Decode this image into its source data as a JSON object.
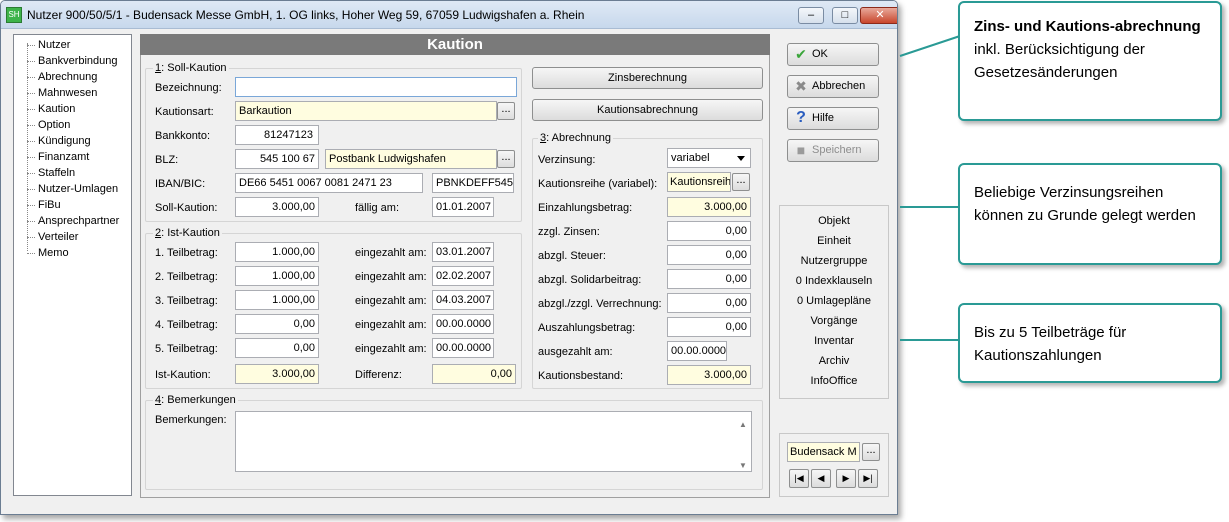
{
  "window": {
    "title": "Nutzer 900/50/5/1 - Budensack Messe GmbH, 1. OG links, Hoher Weg 59, 67059 Ludwigshafen a. Rhein",
    "icon_text": "SH"
  },
  "tree": {
    "items": [
      "Nutzer",
      "Bankverbindung",
      "Abrechnung",
      "Mahnwesen",
      "Kaution",
      "Option",
      "Kündigung",
      "Finanzamt",
      "Staffeln",
      "Nutzer-Umlagen",
      "FiBu",
      "Ansprechpartner",
      "Verteiler",
      "Memo"
    ]
  },
  "header": {
    "title": "Kaution"
  },
  "soll": {
    "group_num": "1",
    "group_rest": ": Soll-Kaution",
    "bezeichnung_label": "Bezeichnung:",
    "bezeichnung_value": "",
    "kautionsart_label": "Kautionsart:",
    "kautionsart_value": "Barkaution",
    "bankkonto_label": "Bankkonto:",
    "bankkonto_value": "81247123",
    "blz_label": "BLZ:",
    "blz_value": "545 100 67",
    "bank_name": "Postbank Ludwigshafen",
    "iban_label": "IBAN/BIC:",
    "iban_value": "DE66 5451 0067 0081 2471 23",
    "bic_value": "PBNKDEFF545",
    "soll_label": "Soll-Kaution:",
    "soll_value": "3.000,00",
    "faellig_label": "fällig am:",
    "faellig_value": "01.01.2007"
  },
  "ist": {
    "group_num": "2",
    "group_rest": ": Ist-Kaution",
    "rows": [
      {
        "label": "1. Teilbetrag:",
        "value": "1.000,00",
        "date_label": "eingezahlt am:",
        "date": "03.01.2007"
      },
      {
        "label": "2. Teilbetrag:",
        "value": "1.000,00",
        "date_label": "eingezahlt am:",
        "date": "02.02.2007"
      },
      {
        "label": "3. Teilbetrag:",
        "value": "1.000,00",
        "date_label": "eingezahlt am:",
        "date": "04.03.2007"
      },
      {
        "label": "4. Teilbetrag:",
        "value": "0,00",
        "date_label": "eingezahlt am:",
        "date": "00.00.0000"
      },
      {
        "label": "5. Teilbetrag:",
        "value": "0,00",
        "date_label": "eingezahlt am:",
        "date": "00.00.0000"
      }
    ],
    "ist_label": "Ist-Kaution:",
    "ist_value": "3.000,00",
    "diff_label": "Differenz:",
    "diff_value": "0,00"
  },
  "actions": {
    "zins_label": "Zinsberechnung",
    "kaution_label": "Kautionsabrechnung"
  },
  "abrechnung": {
    "group_num": "3",
    "group_rest": ": Abrechnung",
    "verzinsung_label": "Verzinsung:",
    "verzinsung_value": "variabel",
    "reihe_label": "Kautionsreihe (variabel):",
    "reihe_value": "Kautionsreih",
    "einzahlung_label": "Einzahlungsbetrag:",
    "einzahlung_value": "3.000,00",
    "zinsen_label": "zzgl. Zinsen:",
    "zinsen_value": "0,00",
    "steuer_label": "abzgl. Steuer:",
    "steuer_value": "0,00",
    "soli_label": "abzgl. Solidarbeitrag:",
    "soli_value": "0,00",
    "verrechnung_label": "abzgl./zzgl. Verrechnung:",
    "verrechnung_value": "0,00",
    "auszahlung_label": "Auszahlungsbetrag:",
    "auszahlung_value": "0,00",
    "ausgezahlt_label": "ausgezahlt am:",
    "ausgezahlt_value": "00.00.0000",
    "bestand_label": "Kautionsbestand:",
    "bestand_value": "3.000,00"
  },
  "bemerkungen": {
    "group_num": "4",
    "group_rest": ": Bemerkungen",
    "label": "Bemerkungen:",
    "value": ""
  },
  "side": {
    "ok": "OK",
    "abbrechen": "Abbrechen",
    "hilfe": "Hilfe",
    "speichern": "Speichern",
    "info_items": [
      "Objekt",
      "Einheit",
      "Nutzergruppe",
      "0 Indexklauseln",
      "0 Umlagepläne",
      "Vorgänge",
      "Inventar",
      "Archiv",
      "InfoOffice"
    ],
    "nav_value": "Budensack M"
  },
  "callouts": {
    "c1_bold": "Zins- und Kautions-abrechnung",
    "c1_rest": " inkl. Berücksichtigung der Gesetzesänderungen",
    "c2": "Beliebige Verzinsungsreihen können zu Grunde gelegt werden",
    "c3": "Bis zu 5 Teilbeträge für Kautionszahlungen"
  },
  "colors": {
    "accent": "#2a9a95",
    "header_bg": "#7a7a7a",
    "highlight_field": "#fffde0"
  }
}
